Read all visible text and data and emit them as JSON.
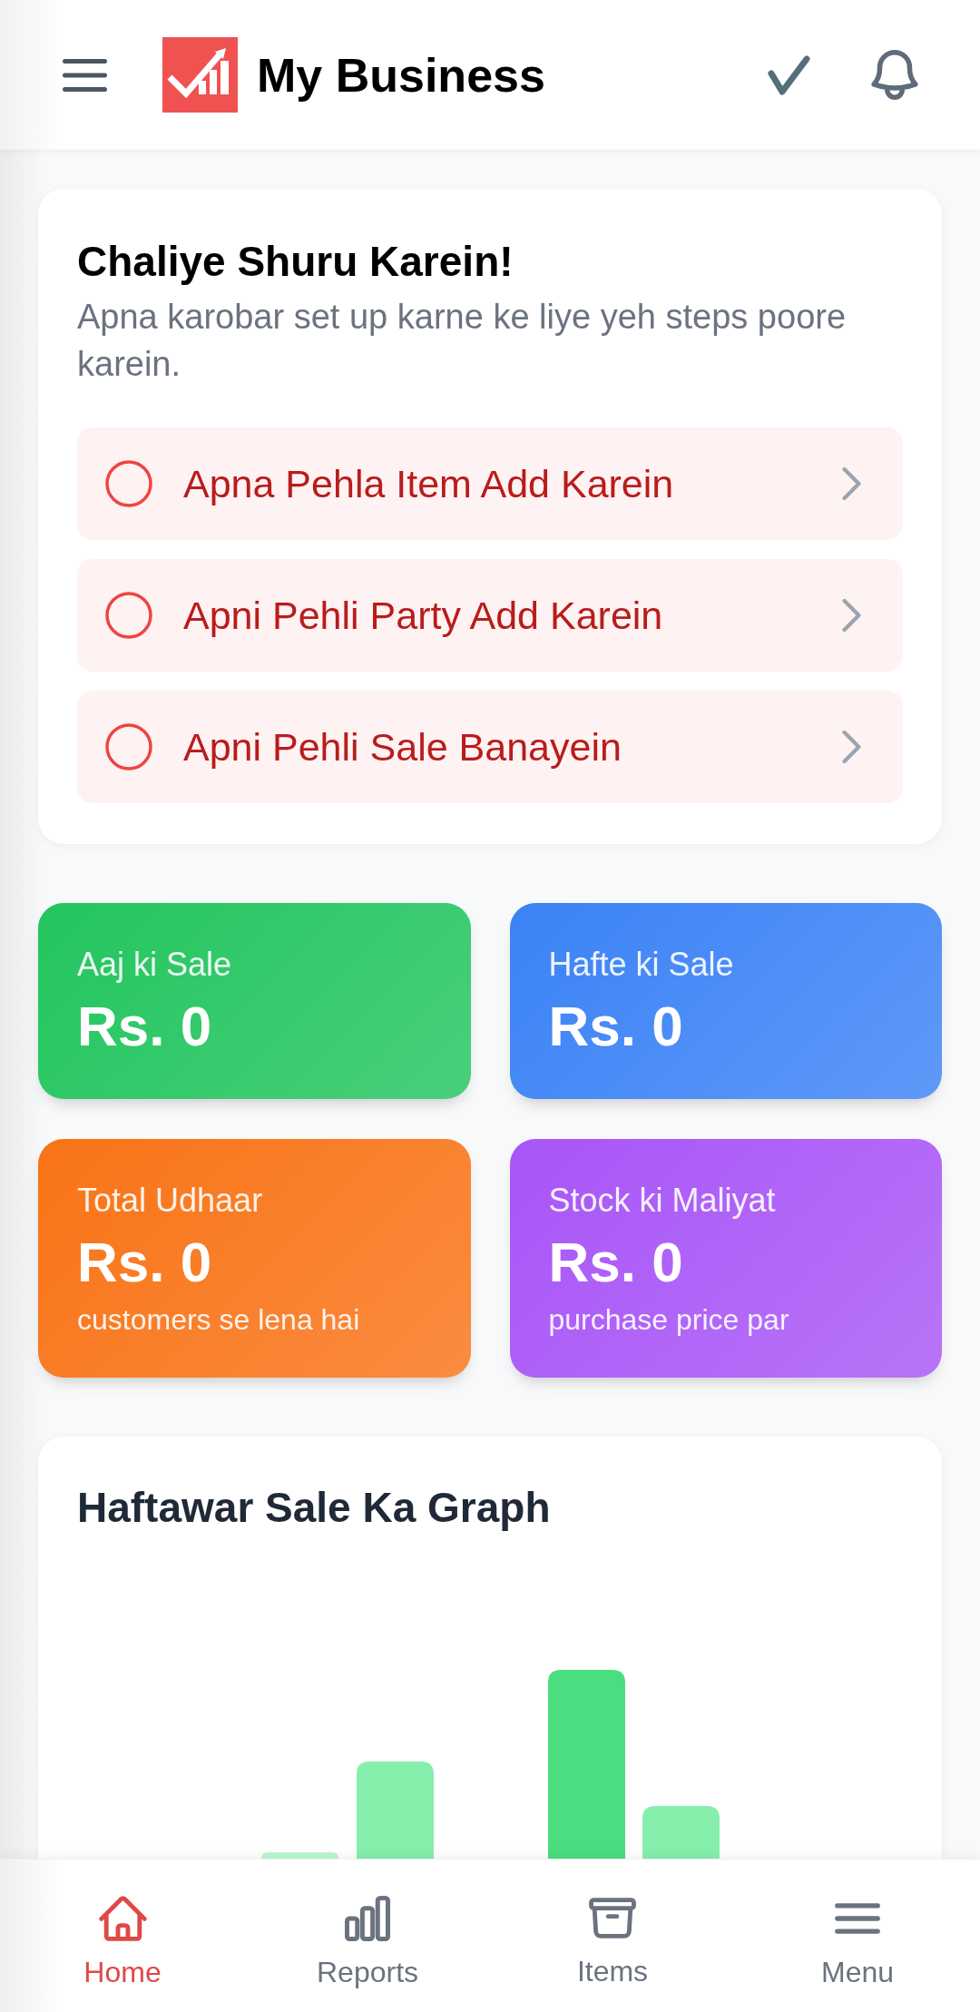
{
  "header": {
    "title": "My Business"
  },
  "setup_card": {
    "title": "Chaliye Shuru Karein!",
    "subtitle": "Apna karobar set up karne ke liye yeh steps poore karein.",
    "steps": [
      {
        "label": "Apna Pehla Item Add Karein",
        "checked": false
      },
      {
        "label": "Apni Pehli Party Add Karein",
        "checked": false
      },
      {
        "label": "Apni Pehli Sale Banayein",
        "checked": false
      }
    ]
  },
  "stats": [
    {
      "label": "Aaj ki Sale",
      "value": "Rs. 0",
      "color": "#22c55e"
    },
    {
      "label": "Hafte ki Sale",
      "value": "Rs. 0",
      "color": "#3b82f6"
    },
    {
      "label": "Total Udhaar",
      "value": "Rs. 0",
      "note": "customers se lena hai",
      "color": "#f97316"
    },
    {
      "label": "Stock ki Maliyat",
      "value": "Rs. 0",
      "note": "purchase price par",
      "color": "#a855f7"
    }
  ],
  "chart": {
    "title": "Haftawar Sale Ka Graph"
  },
  "bottom_nav": [
    {
      "label": "Home",
      "selected": true
    },
    {
      "label": "Reports",
      "selected": false
    },
    {
      "label": "Items",
      "selected": false
    },
    {
      "label": "Menu",
      "selected": false
    }
  ]
}
